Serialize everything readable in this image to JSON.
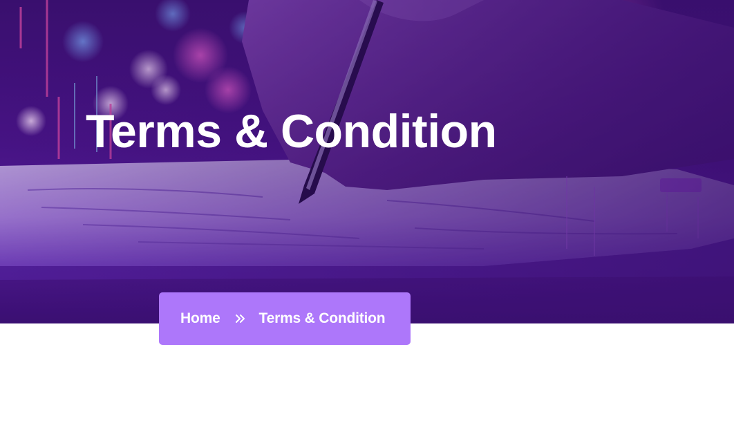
{
  "hero": {
    "title": "Terms & Condition",
    "background_image": "hand-signing-document-purple",
    "overlay_color": "#4a1489"
  },
  "breadcrumb": {
    "items": [
      {
        "label": "Home",
        "link": true
      },
      {
        "label": "Terms & Condition",
        "link": false
      }
    ],
    "separator_icon": "double-chevron-right-icon",
    "background_color": "#ad77fa"
  }
}
